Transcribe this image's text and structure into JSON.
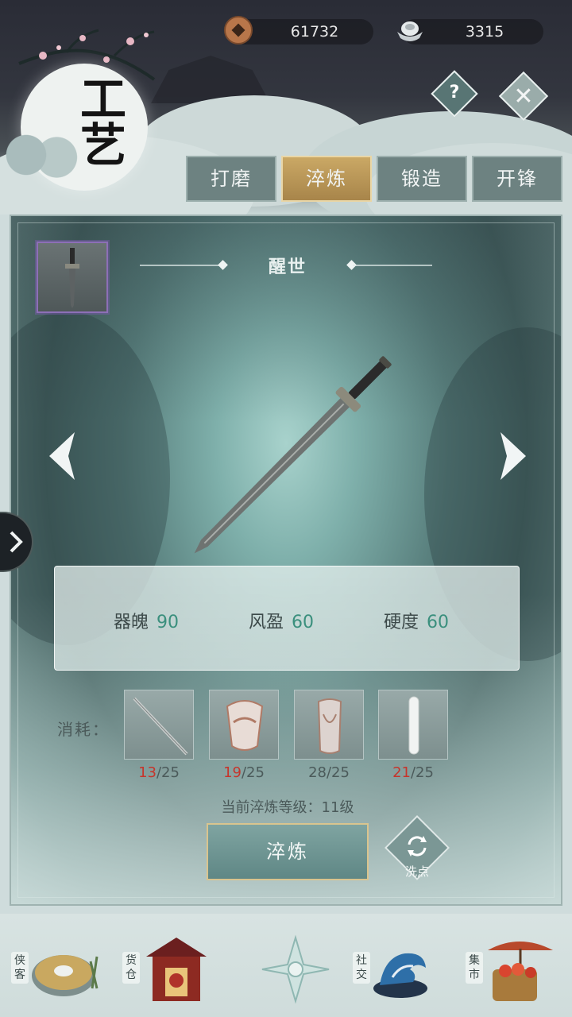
{
  "header": {
    "title_char_1": "工",
    "title_char_2": "艺",
    "copper_amount": "61732",
    "silver_amount": "3315",
    "help_label": "?",
    "close_label": "✕"
  },
  "tabs": [
    {
      "label": "打磨",
      "active": false
    },
    {
      "label": "淬炼",
      "active": true
    },
    {
      "label": "锻造",
      "active": false
    },
    {
      "label": "开锋",
      "active": false
    }
  ],
  "weapon": {
    "name": "醒世"
  },
  "stats": [
    {
      "label": "器魄",
      "value": "90"
    },
    {
      "label": "风盈",
      "value": "60"
    },
    {
      "label": "硬度",
      "value": "60"
    }
  ],
  "consume": {
    "label": "消耗：",
    "materials": [
      {
        "icon": "rod-icon",
        "have": "13",
        "need": "/25",
        "insufficient": true
      },
      {
        "icon": "armor-piece-icon",
        "have": "19",
        "need": "/25",
        "insufficient": true
      },
      {
        "icon": "bracer-icon",
        "have": "28",
        "need": "/25",
        "insufficient": false
      },
      {
        "icon": "jade-bar-icon",
        "have": "21",
        "need": "/25",
        "insufficient": true
      }
    ]
  },
  "level_text": "当前淬炼等级：11级",
  "actions": {
    "refine_label": "淬炼",
    "wash_label": "洗点"
  },
  "bottom_nav": [
    {
      "tag": "侠客",
      "icon": "disc-icon"
    },
    {
      "tag": "货仓",
      "icon": "shop-icon"
    },
    {
      "tag": "",
      "icon": "compass-icon"
    },
    {
      "tag": "社交",
      "icon": "wave-icon"
    },
    {
      "tag": "集市",
      "icon": "market-icon"
    }
  ],
  "colors": {
    "accent_gold": "#caa865",
    "stat_value": "#3a8f7d",
    "insufficient": "#c6352c"
  }
}
